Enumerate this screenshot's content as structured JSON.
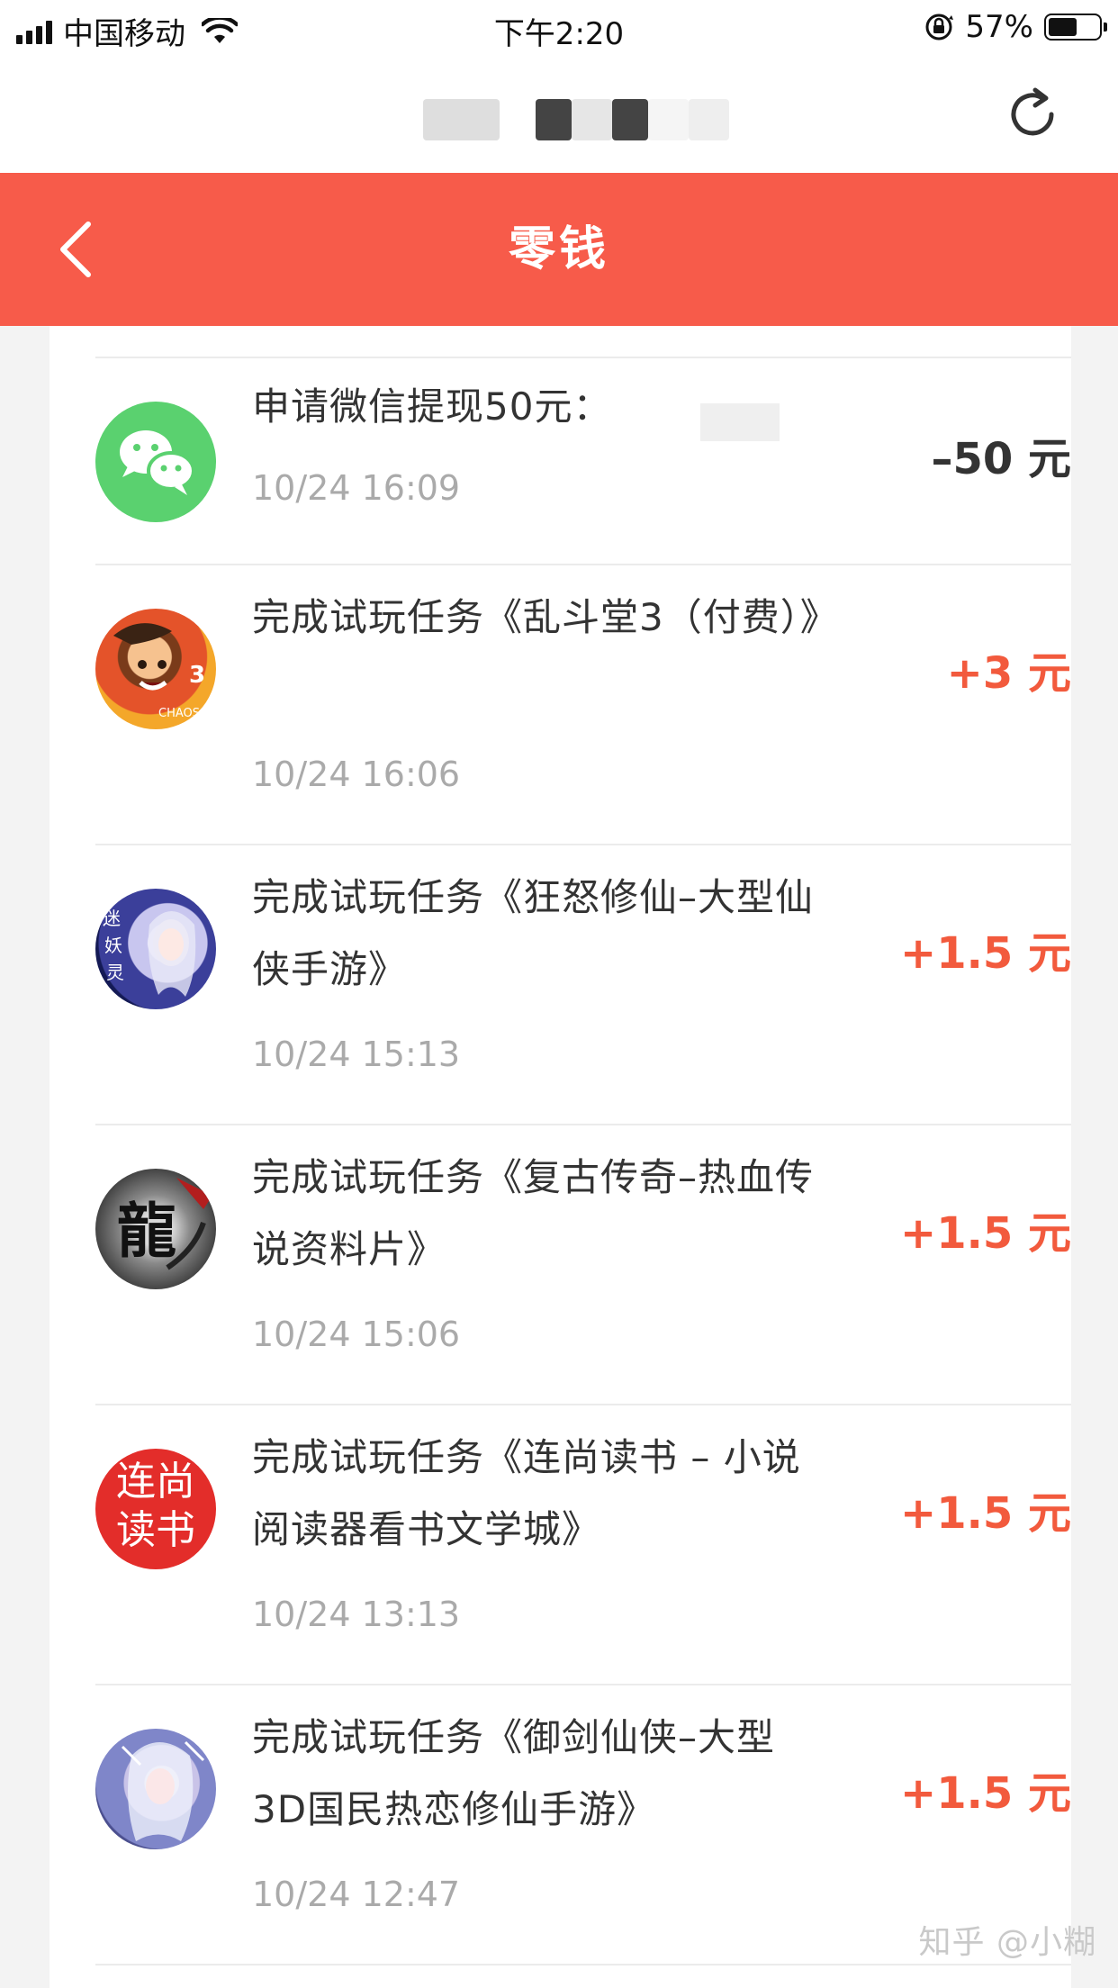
{
  "status_bar": {
    "carrier": "中国移动",
    "time": "下午2:20",
    "battery_percent_label": "57%",
    "battery_level": 0.57
  },
  "header": {
    "title": "零钱",
    "accent_color": "#f75b4a"
  },
  "transactions": [
    {
      "title": "申请微信提现50元：",
      "time": "10/24 16:09",
      "amount": "–50 元",
      "kind": "withdraw",
      "icon": "wechat-icon"
    },
    {
      "title": "完成试玩任务《乱斗堂3（付费）》",
      "time": "10/24 16:06",
      "amount": "+3 元",
      "kind": "income",
      "icon": "game-icon-luandoutang"
    },
    {
      "title": "完成试玩任务《狂怒修仙–大型仙侠手游》",
      "time": "10/24 15:13",
      "amount": "+1.5 元",
      "kind": "income",
      "icon": "game-icon-kuangnu"
    },
    {
      "title": "完成试玩任务《复古传奇–热血传说资料片》",
      "time": "10/24 15:06",
      "amount": "+1.5 元",
      "kind": "income",
      "icon": "game-icon-fugu"
    },
    {
      "title": "完成试玩任务《连尚读书 – 小说阅读器看书文学城》",
      "time": "10/24 13:13",
      "amount": "+1.5 元",
      "kind": "income",
      "icon": "app-icon-lianshang"
    },
    {
      "title": "完成试玩任务《御剑仙侠–大型3D国民热恋修仙手游》",
      "time": "10/24 12:47",
      "amount": "+1.5 元",
      "kind": "income",
      "icon": "game-icon-yujian"
    }
  ],
  "lianshang_icon_text": {
    "line1": "连尚",
    "line2": "读书"
  },
  "watermark": "知乎 @小糊",
  "colors": {
    "income": "#f25a3d",
    "withdraw": "#333333",
    "wechat": "#5ad16f"
  }
}
